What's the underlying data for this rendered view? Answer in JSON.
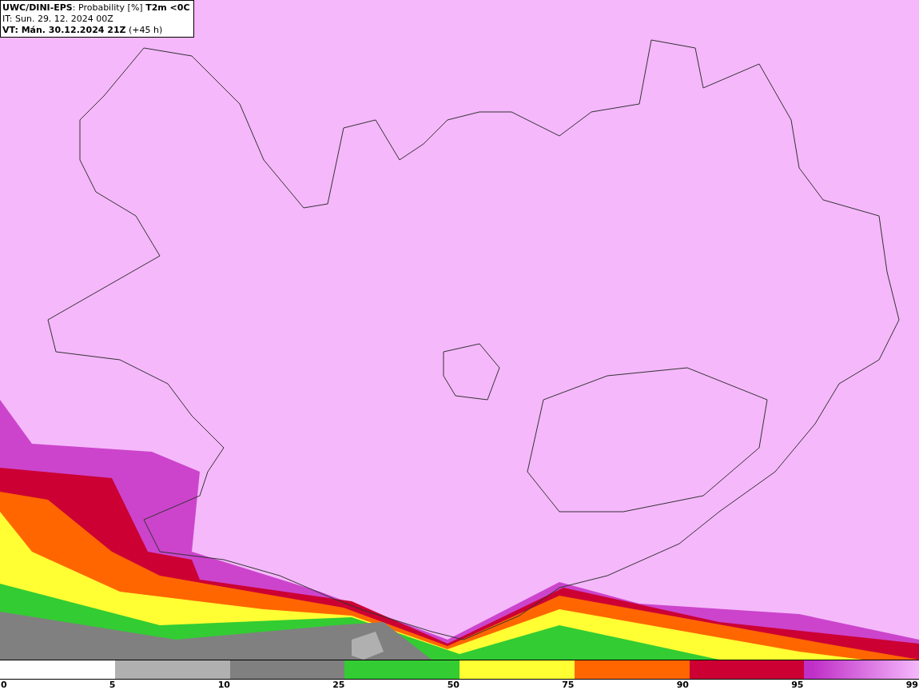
{
  "header": {
    "title": "**UWC/DINI-EPS**: Probability [%] **T2m <0C**",
    "init_time": "IT: Sun. 29. 12. 2024 00Z",
    "valid_time": "**VT: Mán. 30.12.2024 21Z** (+45 h)"
  },
  "legend": {
    "segments": [
      {
        "color": "#b0b0b0"
      },
      {
        "color": "#808080"
      },
      {
        "color": "#33cc33"
      },
      {
        "color": "#ffff33"
      },
      {
        "color": "#ff6600"
      },
      {
        "color": "#cc0033"
      },
      {
        "color": "#c030c8",
        "kind": "gradient"
      }
    ],
    "labels": [
      "0",
      "5",
      "10",
      "25",
      "50",
      "75",
      "90",
      "95",
      "99"
    ]
  }
}
